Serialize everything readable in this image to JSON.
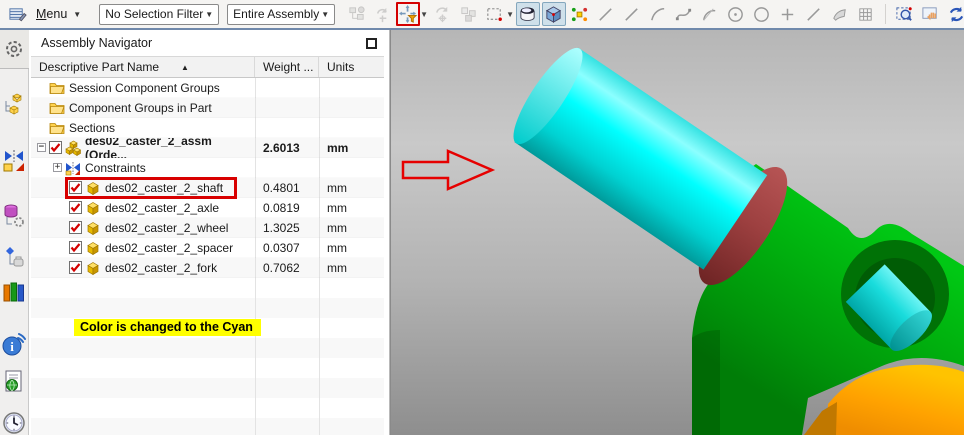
{
  "toolbar": {
    "menu_label": "Menu",
    "selection_filter_value": "No Selection Filter",
    "selection_scope_value": "Entire Assembly",
    "icons": [
      {
        "icon": "assembly-constraints",
        "disabled": true
      },
      {
        "icon": "move-component",
        "disabled": true
      },
      {
        "icon": "selection-filter",
        "red_box": true,
        "dropdown": true
      },
      {
        "icon": "reposition-component",
        "disabled": true
      },
      {
        "icon": "pattern-component",
        "disabled": true
      },
      {
        "icon": "rectangle-select",
        "dropdown": true
      },
      {
        "icon": "shaded-with-edges",
        "selected": true
      },
      {
        "icon": "shaded",
        "selected": true
      },
      {
        "icon": "snap-point"
      },
      {
        "icon": "line"
      },
      {
        "icon": "line"
      },
      {
        "icon": "arc"
      },
      {
        "icon": "spline"
      },
      {
        "icon": "arc-fan"
      },
      {
        "icon": "circle-center"
      },
      {
        "icon": "circle"
      },
      {
        "icon": "point-plus"
      },
      {
        "icon": "line"
      },
      {
        "icon": "sheet"
      },
      {
        "icon": "grid"
      },
      {
        "icon": "separator"
      },
      {
        "icon": "zoom-window"
      },
      {
        "icon": "pan"
      },
      {
        "icon": "rotate"
      },
      {
        "icon": "clipped-icon"
      }
    ]
  },
  "sidebar": {
    "items": [
      {
        "icon": "gear"
      },
      {
        "icon": "assembly-navigator",
        "active": true
      },
      {
        "icon": "constraint-navigator"
      },
      {
        "icon": "part-navigator"
      },
      {
        "icon": "reuse-library"
      },
      {
        "icon": "library-books"
      },
      {
        "icon": "internet-info"
      },
      {
        "icon": "web-page"
      },
      {
        "icon": "history-clock"
      }
    ]
  },
  "navigator": {
    "title": "Assembly Navigator",
    "columns": {
      "name": "Descriptive Part Name",
      "weight": "Weight ...",
      "units": "Units"
    },
    "rows": [
      {
        "label": "Session Component Groups",
        "icon": "folder",
        "indent": 18,
        "weight": "",
        "units": ""
      },
      {
        "label": "Component Groups in Part",
        "icon": "folder",
        "indent": 18,
        "weight": "",
        "units": ""
      },
      {
        "label": "Sections",
        "icon": "folder",
        "indent": 18,
        "weight": "",
        "units": ""
      },
      {
        "label": "des02_caster_2_assm (Orde...",
        "icon": "assembly",
        "indent": 6,
        "expander": "minus",
        "checkbox": true,
        "bold": true,
        "weight": "2.6013",
        "units": "mm"
      },
      {
        "label": "Constraints",
        "icon": "constraints",
        "indent": 22,
        "expander": "plus",
        "weight": "",
        "units": ""
      },
      {
        "label": "des02_caster_2_shaft",
        "icon": "part",
        "indent": 38,
        "checkbox": true,
        "highlight": true,
        "weight": "0.4801",
        "units": "mm"
      },
      {
        "label": "des02_caster_2_axle",
        "icon": "part",
        "indent": 38,
        "checkbox": true,
        "weight": "0.0819",
        "units": "mm"
      },
      {
        "label": "des02_caster_2_wheel",
        "icon": "part",
        "indent": 38,
        "checkbox": true,
        "weight": "1.3025",
        "units": "mm"
      },
      {
        "label": "des02_caster_2_spacer",
        "icon": "part",
        "indent": 38,
        "checkbox": true,
        "weight": "0.0307",
        "units": "mm"
      },
      {
        "label": "des02_caster_2_fork",
        "icon": "part",
        "indent": 38,
        "checkbox": true,
        "weight": "0.7062",
        "units": "mm"
      }
    ],
    "note": "Color is changed to the Cyan"
  },
  "viewport": {
    "annotation_arrow_color": "#e60000",
    "highlight_color": "#d80000",
    "note_highlight_color": "#ffff00",
    "parts": [
      {
        "name": "shaft",
        "color": "#00ffff"
      },
      {
        "name": "spacer-ring",
        "color": "#a04545"
      },
      {
        "name": "fork",
        "color": "#00b40c"
      },
      {
        "name": "axle",
        "color": "#19dcdc"
      },
      {
        "name": "wheel",
        "color": "#ffa200"
      }
    ]
  }
}
